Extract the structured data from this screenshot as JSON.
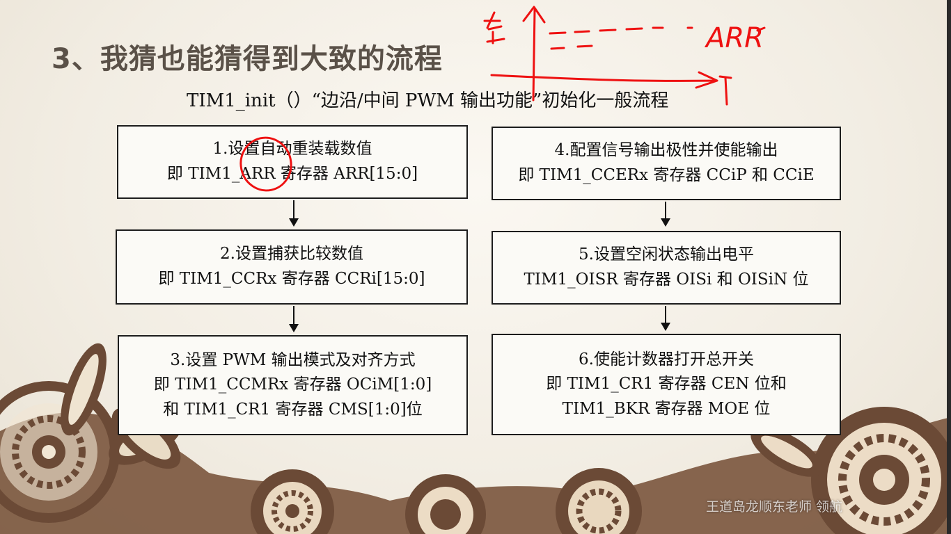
{
  "slide": {
    "title": "3、我猜也能猜得到大致的流程",
    "subtitle": "TIM1_init（）“边沿/中间 PWM 输出功能”初始化一般流程"
  },
  "steps_left": [
    {
      "line1": "1.设置自动重装载数值",
      "line2": "即 TIM1_ARR 寄存器 ARR[15:0]"
    },
    {
      "line1": "2.设置捕获比较数值",
      "line2": "即 TIM1_CCRx 寄存器 CCRi[15:0]"
    },
    {
      "line1": "3.设置 PWM 输出模式及对齐方式",
      "line2": "即 TIM1_CCMRx 寄存器 OCiM[1:0]",
      "line3": "和 TIM1_CR1 寄存器 CMS[1:0]位"
    }
  ],
  "steps_right": [
    {
      "line1": "4.配置信号输出极性并使能输出",
      "line2": "即 TIM1_CCERx 寄存器 CCiP 和 CCiE"
    },
    {
      "line1": "5.设置空闲状态输出电平",
      "line2": "TIM1_OISR 寄存器 OISi 和 OISiN 位"
    },
    {
      "line1": "6.使能计数器打开总开关",
      "line2": "即 TIM1_CR1 寄存器 CEN 位和",
      "line3": "TIM1_BKR 寄存器 MOE 位"
    }
  ],
  "annotation": {
    "handwritten_label": "ARR",
    "color": "#e11111"
  },
  "watermark": "王道岛龙顺东老师  领航",
  "colors": {
    "title": "#5a5148",
    "box_border": "#1c1c1c",
    "decor": "#6b4a36"
  }
}
